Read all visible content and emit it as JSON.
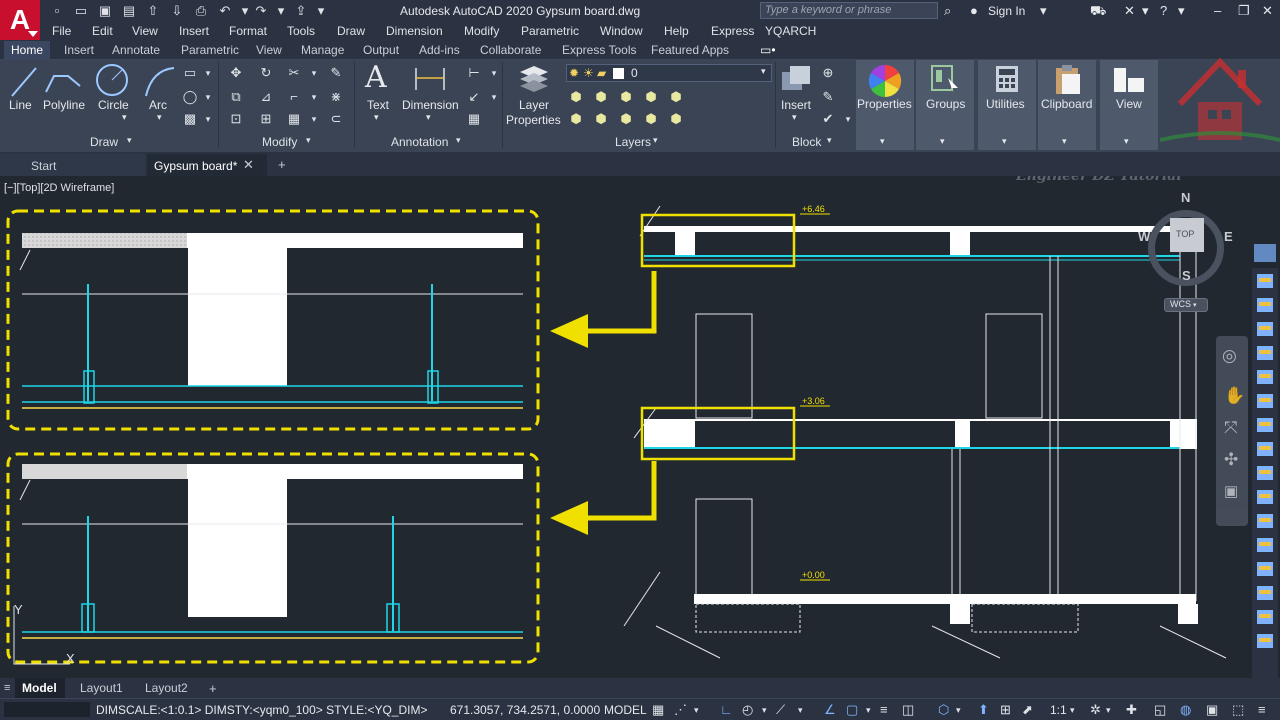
{
  "app": {
    "logo_letter": "A",
    "window_title": "Autodesk AutoCAD 2020   Gypsum board.dwg",
    "search_placeholder": "Type a keyword or phrase",
    "signin_label": "Sign In"
  },
  "menu": [
    "File",
    "Edit",
    "View",
    "Insert",
    "Format",
    "Tools",
    "Draw",
    "Dimension",
    "Modify",
    "Parametric",
    "Window",
    "Help",
    "Express",
    "YQARCH"
  ],
  "ribbon_tabs": [
    "Home",
    "Insert",
    "Annotate",
    "Parametric",
    "View",
    "Manage",
    "Output",
    "Add-ins",
    "Collaborate",
    "Express Tools",
    "Featured Apps"
  ],
  "ribbon": {
    "draw": {
      "title": "Draw",
      "line": "Line",
      "polyline": "Polyline",
      "circle": "Circle",
      "arc": "Arc"
    },
    "modify": {
      "title": "Modify"
    },
    "annotation": {
      "title": "Annotation",
      "text": "Text",
      "dimension": "Dimension"
    },
    "layers": {
      "title": "Layers",
      "layer_properties_1": "Layer",
      "layer_properties_2": "Properties",
      "current_layer": "0"
    },
    "block": {
      "title": "Block",
      "insert": "Insert"
    },
    "properties": "Properties",
    "groups": "Groups",
    "utilities": "Utilities",
    "clipboard": "Clipboard",
    "view": "View"
  },
  "file_tabs": {
    "start": "Start",
    "active": "Gypsum board*"
  },
  "viewport_label": "[−][Top][2D Wireframe]",
  "drawing": {
    "levels": [
      "+6.46",
      "+3.06",
      "+0.00"
    ],
    "watermark": "Engineer DZ Tutorial",
    "axis_y": "Y",
    "axis_x": "X"
  },
  "viewcube": {
    "north": "N",
    "south": "S",
    "west": "W",
    "east": "E",
    "top": "TOP",
    "wcs": "WCS"
  },
  "layout_tabs": {
    "model": "Model",
    "layout1": "Layout1",
    "layout2": "Layout2"
  },
  "status": {
    "command": "DIMSCALE:<1:0.1> DIMSTY:<yqm0_100> STYLE:<YQ_DIM>",
    "coordinates": "671.3057, 734.2571, 0.0000",
    "mode": "MODEL",
    "scale": "1:1"
  },
  "colors": {
    "accent_yellow": "#f0e000",
    "cyan": "#1ed6e6",
    "canvas": "#212830",
    "ribbon": "#3b4455"
  }
}
